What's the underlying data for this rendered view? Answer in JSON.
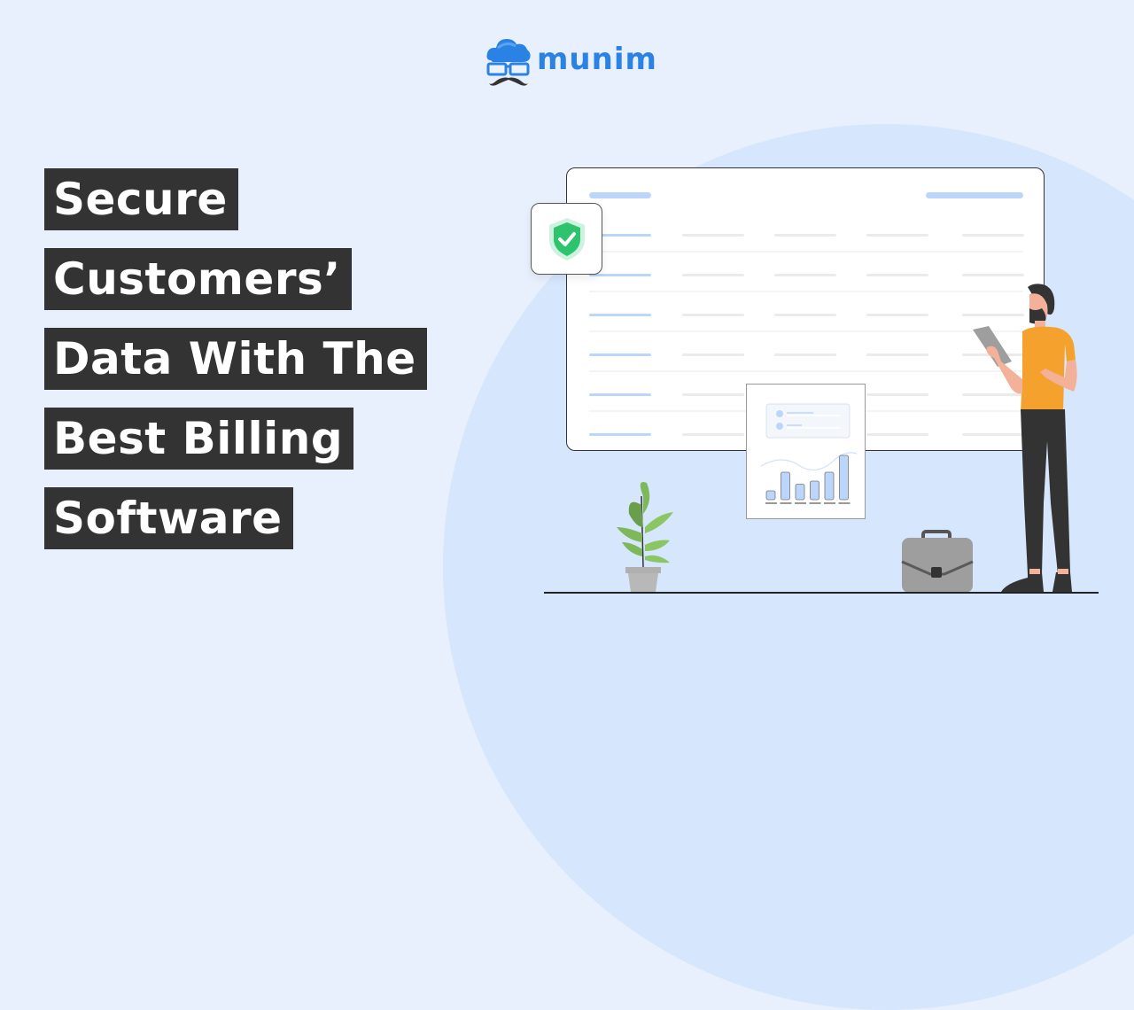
{
  "brand": {
    "name": "munim",
    "logo_icon": "cloud-glasses-mustache-icon",
    "color": "#2a82e4"
  },
  "headline": {
    "lines": [
      "Secure",
      "Customers’",
      "Data With The",
      "Best Billing",
      "Software"
    ],
    "highlight_color": "#333333",
    "text_color": "#ffffff"
  },
  "illustration": {
    "table_rows": 6,
    "table_columns": 5,
    "shield_icon": "shield-check-icon",
    "report_icon": "report-bar-chart-icon",
    "objects": [
      "plant-icon",
      "briefcase-icon",
      "person-with-tablet"
    ]
  },
  "colors": {
    "background": "#e8f0fd",
    "circle": "#d6e6fc",
    "accent_line": "#bcd6fb",
    "shield_green": "#2ec46d"
  }
}
